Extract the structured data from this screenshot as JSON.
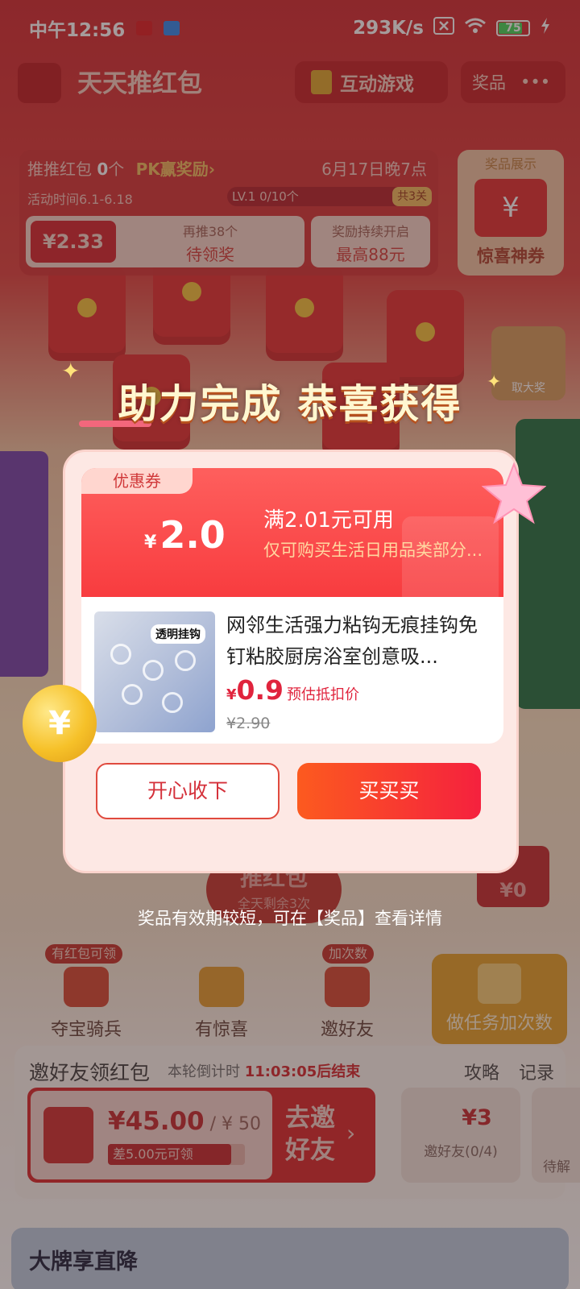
{
  "status_bar": {
    "time": "中午12:56",
    "net_speed": "293K/s",
    "battery": "75"
  },
  "nav": {
    "title": "天天推红包",
    "game_label": "互动游戏",
    "prize_label": "奖品",
    "more_label": "•••"
  },
  "activity": {
    "count_prefix": "推推红包 ",
    "count": "0",
    "count_suffix": "个",
    "pk_label": "PK赢奖励",
    "pk_chevron": "›",
    "date": "6月17日晚7点",
    "time_range": "活动时间6.1-6.18",
    "level": "LV.1 0/10个",
    "stage": "共3关",
    "amount": "¥2.33",
    "again": "再推38个",
    "pending": "待领奖",
    "reward_line1": "奖励持续开启",
    "reward_line2": "最高88元"
  },
  "showcase": {
    "title": "奖品展示",
    "label": "惊喜神券",
    "icon": "yen-ticket-icon",
    "icon_glyph": "¥"
  },
  "collect_label": "取大奖",
  "push_button": {
    "label": "推红包",
    "remaining": "全天剩余3次"
  },
  "zero_badge": "¥0",
  "popup": {
    "headline": "助力完成 恭喜获得",
    "coupon_tag": "优惠券",
    "coupon_currency": "¥",
    "coupon_value": "2.0",
    "coupon_condition": "满2.01元可用",
    "coupon_scope": "仅可购买生活日用品类部分...",
    "product_image_tag": "透明挂钩",
    "product_name": "网邻生活强力粘钩无痕挂钩免钉粘胶厨房浴室创意吸...",
    "price_currency": "¥",
    "price": "0.9",
    "price_note": "预估抵扣价",
    "original_price": "¥2.90",
    "keep_button": "开心收下",
    "buy_button": "买买买",
    "hint": "奖品有效期较短，可在【奖品】查看详情",
    "balloon_glyph": "¥"
  },
  "actions": [
    {
      "label": "夺宝骑兵",
      "tag": "有红包可领",
      "icon": "gift-box-icon"
    },
    {
      "label": "有惊喜",
      "tag": "",
      "icon": "sparkle-wand-icon"
    },
    {
      "label": "邀好友",
      "tag": "加次数",
      "icon": "add-user-icon"
    }
  ],
  "task_button": {
    "label": "做任务加次数",
    "icon": "clipboard-check-icon"
  },
  "invite": {
    "title": "邀好友领红包",
    "countdown_prefix": "本轮倒计时 ",
    "countdown": "11:03:05后结束",
    "strategy": "攻略",
    "records": "记录",
    "amount": "¥45.00",
    "target": " / ¥ 50",
    "gap": "差5.00元可领",
    "progress": 0.9,
    "go_label": "去邀好友",
    "chevron": "›",
    "mini_value": "¥3",
    "mini_label": "邀好友(0/4)",
    "mini2_label": "待解"
  },
  "brand_banner": "大牌享直降",
  "colors": {
    "accent_red": "#f83c3f",
    "price_red": "#e0243d",
    "buy_gradient_start": "#fc5a1f",
    "buy_gradient_end": "#f5213e"
  }
}
